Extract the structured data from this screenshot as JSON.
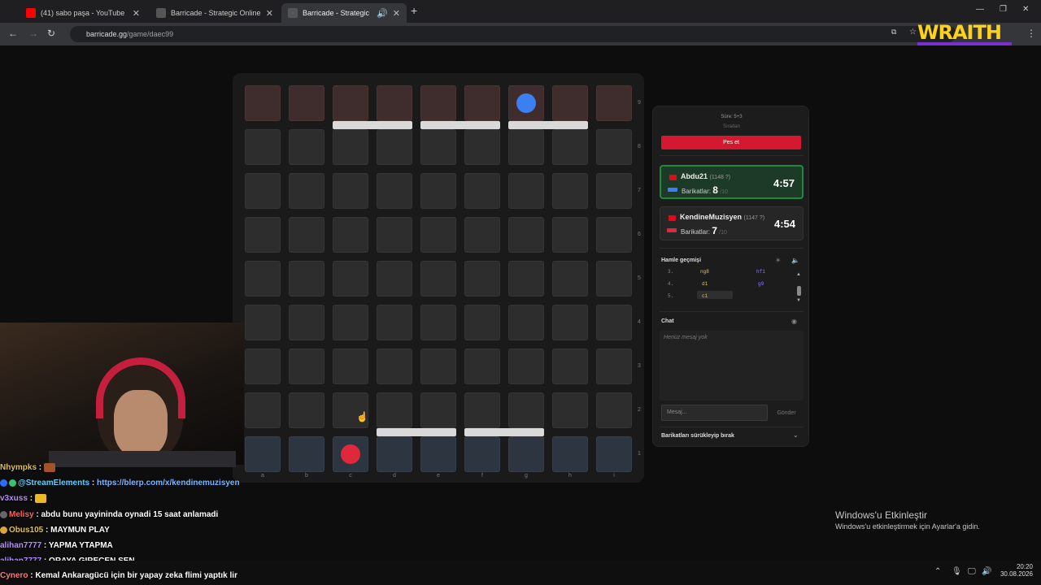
{
  "browser": {
    "tabs": [
      {
        "title": "(41) sabo paşa - YouTube",
        "icon": "youtube-icon",
        "color": "#ff0000"
      },
      {
        "title": "Barricade - Strategic Online Bo",
        "icon": "barricade-favicon",
        "color": "#444444"
      },
      {
        "title": "Barricade - Strategic Online",
        "icon": "barricade-favicon",
        "color": "#444444"
      }
    ],
    "url_host": "barricade.gg",
    "url_path": "/game/daec99",
    "overlay_brand": "WRAITH"
  },
  "board": {
    "rows": [
      "9",
      "8",
      "7",
      "6",
      "5",
      "4",
      "3",
      "2",
      "1"
    ],
    "cols": [
      "a",
      "b",
      "c",
      "d",
      "e",
      "f",
      "g",
      "h",
      "i"
    ],
    "pawn_blue": {
      "square": "g9",
      "color": "#3b7ff0"
    },
    "pawn_red": {
      "square": "c1",
      "color": "#e0283d"
    }
  },
  "panel": {
    "time_control": "Süre: 5+3",
    "turn_label": "Sıradan",
    "resign_label": "Pes et",
    "players": [
      {
        "name": "Abdu21",
        "rating": "(1148 ?)",
        "barriers_label": "Barikatlar:",
        "barriers": "8",
        "barriers_max": "/10",
        "time": "4:57",
        "color": "#3b7ff0"
      },
      {
        "name": "KendineMuzisyen",
        "rating": "(1147 ?)",
        "barriers_label": "Barikatlar:",
        "barriers": "7",
        "barriers_max": "/10",
        "time": "4:54",
        "color": "#e0283d"
      }
    ],
    "history_title": "Hamle geçmişi",
    "moves": [
      {
        "n": "3.",
        "w": "ng8",
        "b": "hf1"
      },
      {
        "n": "4.",
        "w": "d1",
        "b": "g9"
      },
      {
        "n": "5.",
        "w": "c1",
        "b": ""
      }
    ],
    "chat_title": "Chat",
    "chat_empty": "Henüz mesaj yok",
    "message_placeholder": "Mesaj...",
    "send_label": "Gönder",
    "drag_label": "Barikatları sürükleyip bırak"
  },
  "stream_chat": [
    {
      "user": "Nhympks",
      "text": ""
    },
    {
      "user": "@StreamElements",
      "text": "https://blerp.com/x/kendinemuzisyen"
    },
    {
      "user": "v3xuss",
      "text": ""
    },
    {
      "user": "Melisy",
      "text": "abdu bunu yayininda oynadi 15 saat anlamadi"
    },
    {
      "user": "Obus105",
      "text": "MAYMUN PLAY"
    },
    {
      "user": "alihan7777",
      "text": "YAPMA YTAPMA"
    },
    {
      "user": "alihan7777",
      "text": "ORAYA GIRECEN SEN"
    },
    {
      "user": "Cynero",
      "text": "Kemal Ankaragücü için bir yapay zeka flimi yaptık lir"
    }
  ],
  "windows": {
    "activate_title": "Windows'u Etkinleştir",
    "activate_sub": "Windows'u etkinleştirmek için Ayarlar'a gidin.",
    "time": "20:20",
    "date": "30.08.2026"
  }
}
